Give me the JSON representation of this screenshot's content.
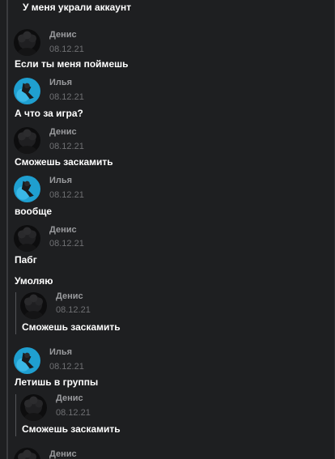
{
  "colors": {
    "background": "#1e1f21",
    "text": "#ffffff",
    "author": "#9a9b9e",
    "date": "#6f7073",
    "rail": "#3a3b3e"
  },
  "top_partial_text": "У меня украли аккаунт",
  "messages": [
    {
      "author": "Денис",
      "avatar": "dark-avatar",
      "date": "08.12.21",
      "text": "Если ты меня поймешь"
    },
    {
      "author": "Илья",
      "avatar": "blue-avatar",
      "date": "08.12.21",
      "text": "А что за игра?"
    },
    {
      "author": "Денис",
      "avatar": "dark-avatar",
      "date": "08.12.21",
      "text": "Сможешь заскамить"
    },
    {
      "author": "Илья",
      "avatar": "blue-avatar",
      "date": "08.12.21",
      "text": "вообще"
    },
    {
      "author": "Денис",
      "avatar": "dark-avatar",
      "date": "08.12.21",
      "text": "Пабг",
      "extra_text": "Умоляю",
      "quote": {
        "author": "Денис",
        "avatar": "dark-avatar",
        "date": "08.12.21",
        "text": "Сможешь заскамить"
      }
    },
    {
      "author": "Илья",
      "avatar": "blue-avatar",
      "date": "08.12.21",
      "text": "Летишь в группы",
      "quote": {
        "author": "Денис",
        "avatar": "dark-avatar",
        "date": "08.12.21",
        "text": "Сможешь заскамить"
      }
    },
    {
      "author": "Денис",
      "avatar": "dark-avatar"
    }
  ]
}
